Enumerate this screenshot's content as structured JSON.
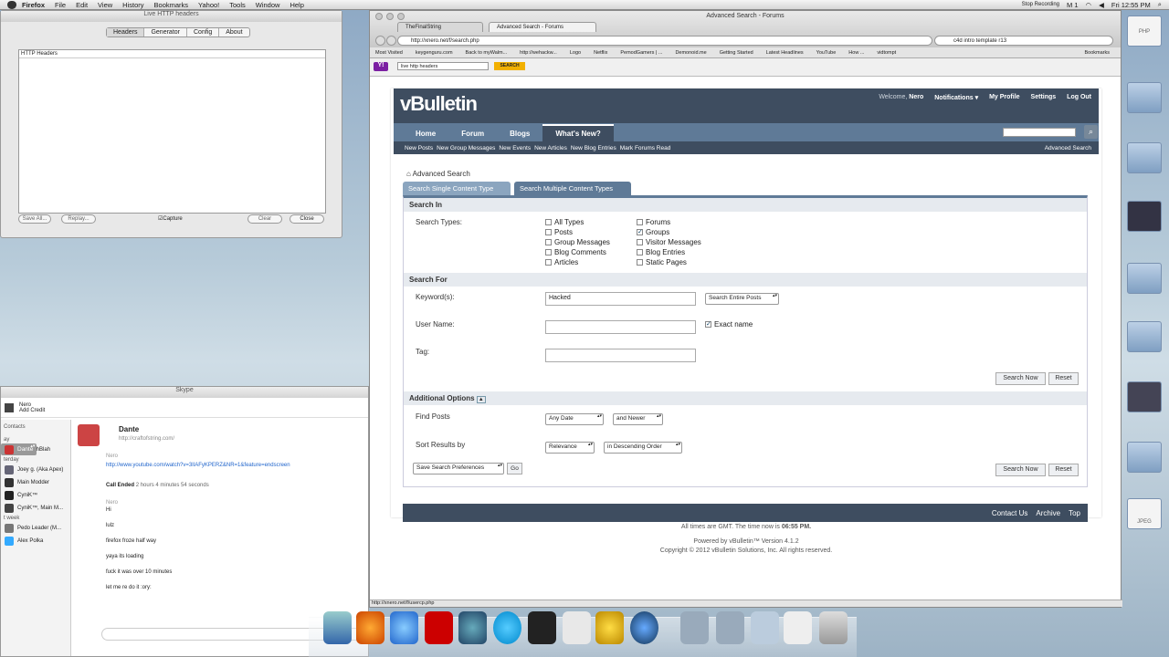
{
  "menubar": {
    "app": "Firefox",
    "items": [
      "File",
      "Edit",
      "View",
      "History",
      "Bookmarks",
      "Yahoo!",
      "Tools",
      "Window",
      "Help"
    ],
    "right": {
      "recording": "Stop Recording",
      "m1": "M 1",
      "clock": "Fri 12:55 PM"
    }
  },
  "lhh": {
    "title": "Live HTTP headers",
    "tabs": [
      "Headers",
      "Generator",
      "Config",
      "About"
    ],
    "box_header": "HTTP Headers",
    "save": "Save All...",
    "replay": "Replay...",
    "capture": "Capture",
    "clear": "Clear",
    "close": "Close"
  },
  "skype": {
    "title": "Skype",
    "user": "Nero",
    "user_sub": "Add Credit",
    "contacts_label": "Contacts",
    "groups": {
      "today": "ay",
      "yesterday": "terday",
      "week": "t week"
    },
    "contacts": [
      "Dante",
      "BlahBlahBlah",
      "Joey g. (Aka Apex)",
      "Main Modder",
      "CyniK™",
      "CyniK™, Main M...",
      "Pedo Leader (M...",
      "Alex Polka"
    ],
    "chat_name": "Dante",
    "chat_sub": "http://craftofstring.com/",
    "sender": "Nero",
    "link": "http://www.youtube.com/watch?v=3lIAFyKPERZ&NR=1&feature=endscreen",
    "call": "Call Ended",
    "call_detail": "2 hours 4 minutes 54 seconds",
    "messages": [
      "Hi",
      "lulz",
      "firefox froze half way",
      "yaya its loading",
      "fuck it was over 10 minutes",
      "let me re do it :ory:"
    ]
  },
  "firefox": {
    "window_title": "Advanced Search - Forums",
    "tabs": [
      "TheFinalString",
      "Advanced Search - Forums"
    ],
    "url": "http://xnero.net/f/search.php",
    "search_value": "c4d intro template r13",
    "bookmarks": [
      "Most Visited",
      "keygenguru.com",
      "Back to myWalm...",
      "http://wehackw...",
      "Logo",
      "Netflix",
      "PemodGamers | ...",
      "Demonoid.me",
      "Getting Started",
      "Latest Headlines",
      "YouTube",
      "How ...",
      "vidtompt",
      "Bookmarks"
    ],
    "yahoo_search": "live http headers",
    "yahoo_btn": "SEARCH",
    "status": "http://xnero.net/f/usercp.php"
  },
  "vb": {
    "logo": "vBulletin",
    "welcome": "Welcome,",
    "user": "Nero",
    "links": [
      "Notifications ▾",
      "My Profile",
      "Settings",
      "Log Out"
    ],
    "nav": [
      "Home",
      "Forum",
      "Blogs",
      "What's New?"
    ],
    "subnav": [
      "New Posts",
      "New Group Messages",
      "New Events",
      "New Articles",
      "New Blog Entries",
      "Mark Forums Read"
    ],
    "advanced": "Advanced Search",
    "crumb": "Advanced Search",
    "tab_single": "Search Single Content Type",
    "tab_multi": "Search Multiple Content Types",
    "search_in": "Search In",
    "search_types_label": "Search Types:",
    "types_col1": [
      "All Types",
      "Posts",
      "Group Messages",
      "Blog Comments",
      "Articles"
    ],
    "types_col2": [
      "Forums",
      "Groups",
      "Visitor Messages",
      "Blog Entries",
      "Static Pages"
    ],
    "search_for": "Search For",
    "keywords_label": "Keyword(s):",
    "keywords_value": "Hacked",
    "keywords_mode": "Search Entire Posts",
    "username_label": "User Name:",
    "exact": "Exact name",
    "tag_label": "Tag:",
    "search_now": "Search Now",
    "reset": "Reset",
    "additional": "Additional Options",
    "find_posts": "Find Posts",
    "date": "Any Date",
    "newer": "and Newer",
    "sort_by": "Sort Results by",
    "relevance": "Relevance",
    "order": "in Descending Order",
    "save_prefs": "Save Search Preferences",
    "go": "Go",
    "footer_links": [
      "Contact Us",
      "Archive",
      "Top"
    ],
    "time_text": "All times are GMT. The time now is",
    "time": "06:55 PM.",
    "powered": "Powered by vBulletin™ Version 4.1.2",
    "copyright": "Copyright © 2012 vBulletin Solutions, Inc. All rights reserved."
  },
  "desktop": [
    "PHP",
    "",
    "",
    "",
    "",
    "",
    "",
    "",
    "",
    "",
    "JPEG"
  ]
}
